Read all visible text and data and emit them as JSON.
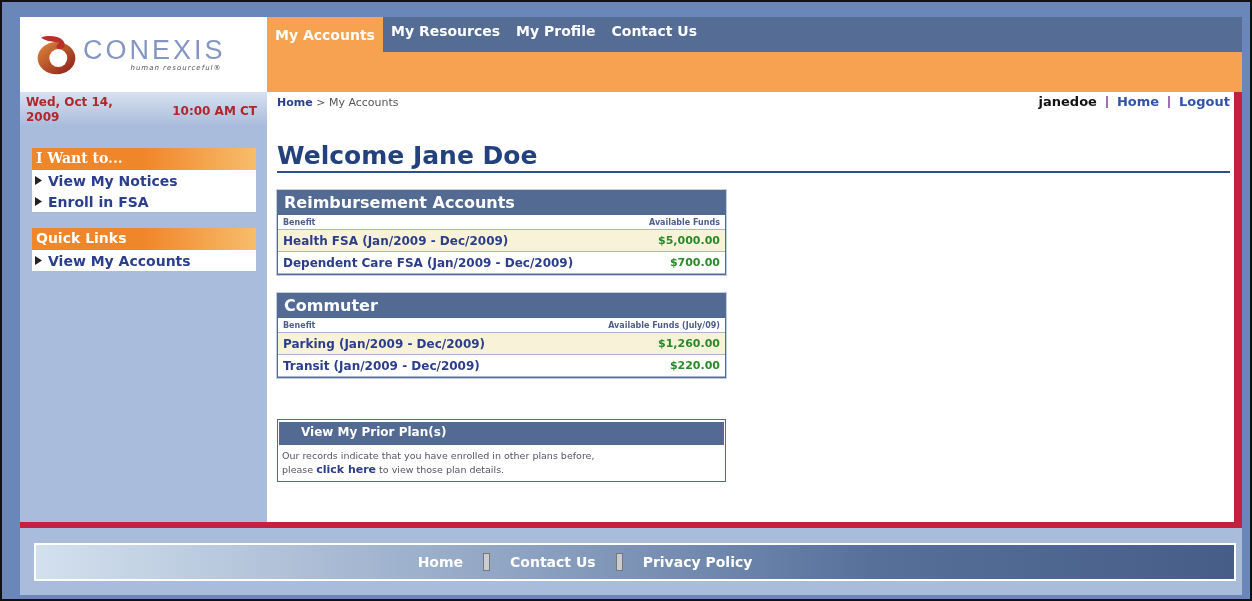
{
  "logo": {
    "name": "CONEXIS",
    "tagline": "human resourceful®"
  },
  "nav": [
    {
      "label": "My Accounts",
      "selected": true
    },
    {
      "label": "My Resources",
      "selected": false
    },
    {
      "label": "My Profile",
      "selected": false
    },
    {
      "label": "Contact Us",
      "selected": false
    }
  ],
  "sidebar": {
    "date": "Wed, Oct 14, 2009",
    "time": "10:00 AM CT",
    "sections": [
      {
        "title": "I Want to...",
        "items": [
          "View My Notices",
          "Enroll in FSA"
        ]
      },
      {
        "title": "Quick Links",
        "items": [
          "View My Accounts"
        ]
      }
    ]
  },
  "breadcrumb": {
    "link": "Home",
    "separator": ">",
    "current": "My Accounts"
  },
  "user_links": {
    "username": "janedoe",
    "links": [
      "Home",
      "Logout"
    ]
  },
  "heading": "Welcome Jane Doe",
  "tables": [
    {
      "title": "Reimbursement Accounts",
      "columns": [
        "Benefit",
        "Available Funds"
      ],
      "rows": [
        {
          "benefit": "Health FSA (Jan/2009 - Dec/2009)",
          "amount": "$5,000.00",
          "highlighted": true
        },
        {
          "benefit": "Dependent Care FSA (Jan/2009 - Dec/2009)",
          "amount": "$700.00",
          "highlighted": false
        }
      ]
    },
    {
      "title": "Commuter",
      "columns": [
        "Benefit",
        "Available Funds (July/09)"
      ],
      "rows": [
        {
          "benefit": "Parking (Jan/2009 - Dec/2009)",
          "amount": "$1,260.00",
          "highlighted": true
        },
        {
          "benefit": "Transit (Jan/2009 - Dec/2009)",
          "amount": "$220.00",
          "highlighted": false
        }
      ]
    }
  ],
  "prior_plans": {
    "title": "View My Prior Plan(s)",
    "text_before": "Our records indicate that you have enrolled in other plans before, please",
    "link": "click here",
    "text_after": "to view those plan details."
  },
  "footer": {
    "links": [
      "Home",
      "Contact Us",
      "Privacy Policy"
    ]
  }
}
